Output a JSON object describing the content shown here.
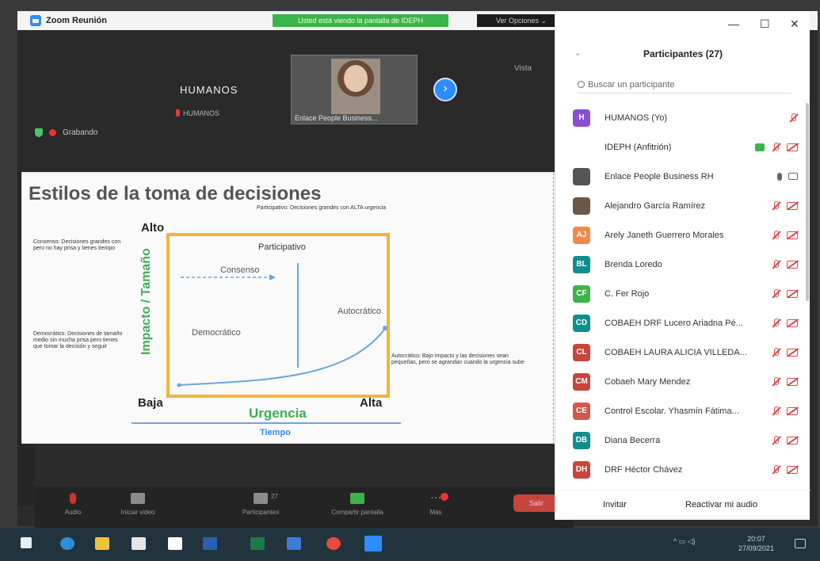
{
  "window": {
    "title": "Zoom Reunión",
    "share_banner": "Usted está viendo la pantalla de IDEPH",
    "view_options": "Ver Opciones ⌄",
    "vista_label": "Vista"
  },
  "video": {
    "self_name": "HUMANOS",
    "self_sub": "HUMANOS",
    "cam_label": "Enlace People Business...",
    "recording_label": "Grabando"
  },
  "slide": {
    "title": "Estilos de la toma de decisiones",
    "note_top": "Participativo: Decisiones grandes con ALTA urgencia",
    "alto": "Alto",
    "baja": "Baja",
    "alta": "Alta",
    "urgencia": "Urgencia",
    "tiempo": "Tiempo",
    "impacto": "Impacto / Tamaño",
    "consenso_note": "Consenso: Decisiones grandes con pero no hay prisa y tienes tiempo",
    "democratico_note": "Democrático: Decisiones de tamaño medio sin mucha prisa pero tienes que tomar la decisión y seguir",
    "autocratico_note": "Autocrático: Bajo impacto y las decisiones sean pequeñas, pero se agrandan cuando la urgencia sube",
    "q_participativo": "Participativo",
    "q_consenso": "Consenso",
    "q_democratico": "Democrático",
    "q_autocratico": "Autocrático"
  },
  "toolbar": {
    "audio": "Audio",
    "video": "Iniciar video",
    "participants": "Participantes",
    "participants_count": "27",
    "share": "Compartir pantalla",
    "more": "Más",
    "leave": "Salir"
  },
  "panel": {
    "title": "Participantes (27)",
    "search_placeholder": "Buscar un participante",
    "invite": "Invitar",
    "unmute": "Reactivar mi audio",
    "participants": [
      {
        "initials": "H",
        "name": "HUMANOS (Yo)",
        "color": "#8a4fd1"
      },
      {
        "initials": "",
        "name": "IDEPH (Anfitrión)",
        "color": "#ffffff"
      },
      {
        "initials": "",
        "name": "Enlace People Business RH",
        "color": "#555555"
      },
      {
        "initials": "",
        "name": "Alejandro García Ramírez",
        "color": "#6d5848"
      },
      {
        "initials": "AJ",
        "name": "Arely Janeth Guerrero Morales",
        "color": "#f08a4b"
      },
      {
        "initials": "BL",
        "name": "Brenda Loredo",
        "color": "#0f8e8e"
      },
      {
        "initials": "CF",
        "name": "C. Fer Rojo",
        "color": "#3bb54a"
      },
      {
        "initials": "CD",
        "name": "COBAEH DRF Lucero Ariadna Pé...",
        "color": "#0f8e8e"
      },
      {
        "initials": "CL",
        "name": "COBAEH LAURA ALICIA VILLEDA...",
        "color": "#c8453c"
      },
      {
        "initials": "CM",
        "name": "Cobaeh Mary Mendez",
        "color": "#c8453c"
      },
      {
        "initials": "CE",
        "name": "Control Escolar. Yhasmín Fátima...",
        "color": "#d4574a"
      },
      {
        "initials": "DB",
        "name": "Diana Becerra",
        "color": "#0f8e8e"
      },
      {
        "initials": "DH",
        "name": "DRF Héctor Chávez",
        "color": "#c8453c"
      }
    ]
  },
  "taskbar": {
    "clock_time": "20:07",
    "clock_date": "27/09/2021"
  }
}
